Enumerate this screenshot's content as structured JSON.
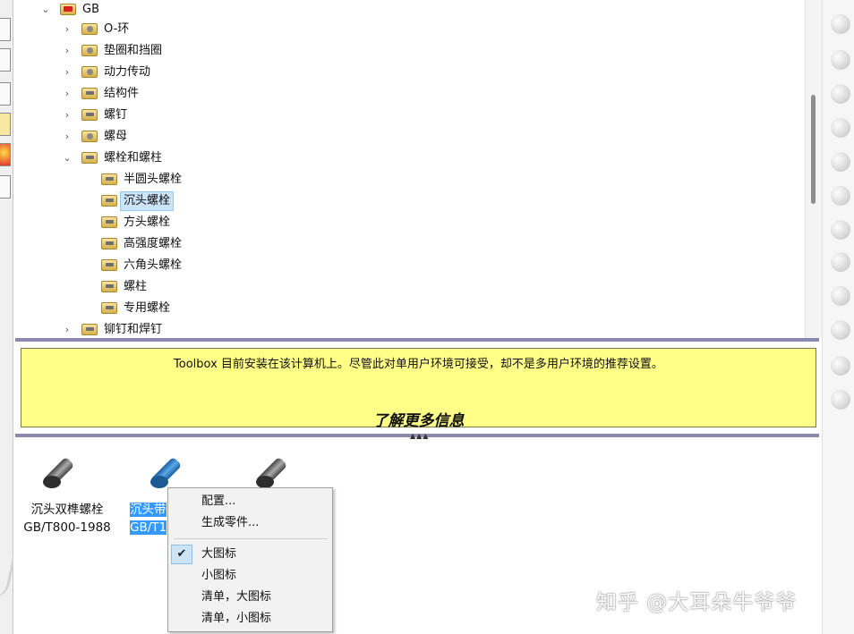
{
  "tree": {
    "root": {
      "label": "GB",
      "icon": "flag-folder-icon",
      "expanded": true
    },
    "items": [
      {
        "label": "O-环",
        "icon": "ring-folder-icon",
        "expanded": false
      },
      {
        "label": "垫圈和挡圈",
        "icon": "washer-folder-icon",
        "expanded": false
      },
      {
        "label": "动力传动",
        "icon": "gear-folder-icon",
        "expanded": false
      },
      {
        "label": "结构件",
        "icon": "beam-folder-icon",
        "expanded": false
      },
      {
        "label": "螺钉",
        "icon": "screw-folder-icon",
        "expanded": false
      },
      {
        "label": "螺母",
        "icon": "nut-folder-icon",
        "expanded": false
      },
      {
        "label": "螺栓和螺柱",
        "icon": "bolt-folder-icon",
        "expanded": true
      },
      {
        "label": "铆钉和焊钉",
        "icon": "rivet-folder-icon",
        "expanded": false
      }
    ],
    "children": [
      {
        "label": "半圆头螺栓",
        "selected": false
      },
      {
        "label": "沉头螺栓",
        "selected": true
      },
      {
        "label": "方头螺栓",
        "selected": false
      },
      {
        "label": "高强度螺栓",
        "selected": false
      },
      {
        "label": "六角头螺栓",
        "selected": false
      },
      {
        "label": "螺柱",
        "selected": false
      },
      {
        "label": "专用螺栓",
        "selected": false
      }
    ]
  },
  "banner": {
    "text": "Toolbox 目前安装在该计算机上。尽管此对单用户环境可接受，却不是多用户环境的推荐设置。",
    "link": "了解更多信息",
    "grip": "▲▲▲"
  },
  "parts": [
    {
      "name": "沉头双榫螺栓",
      "std": "GB/T800-1988",
      "color": "#555555",
      "selected": false
    },
    {
      "name": "沉头带",
      "std": "GB/T1",
      "color": "#2a7fc8",
      "selected": true
    },
    {
      "name": "",
      "std": "",
      "color": "#555555",
      "selected": false
    }
  ],
  "context_menu": {
    "items": [
      {
        "label": "配置..."
      },
      {
        "label": "生成零件..."
      }
    ],
    "view_items": [
      {
        "label": "大图标",
        "checked": true
      },
      {
        "label": "小图标",
        "checked": false
      },
      {
        "label": "清单，大图标",
        "checked": false
      },
      {
        "label": "清单，小图标",
        "checked": false
      }
    ],
    "check_glyph": "✔"
  },
  "watermark": "知乎 @大耳朵牛爷爷",
  "chevrons": {
    "expanded": "⌄",
    "collapsed": "›"
  }
}
